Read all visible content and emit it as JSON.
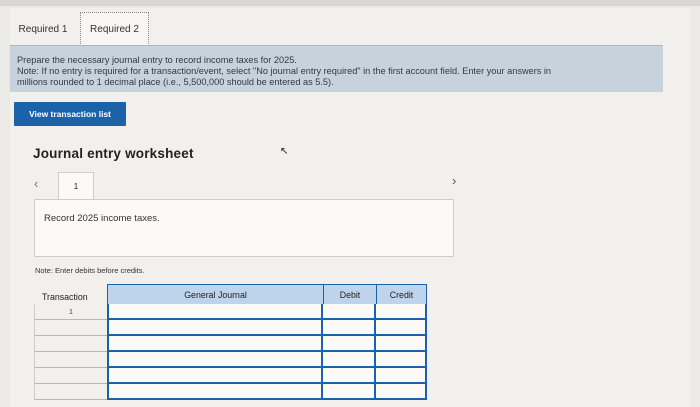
{
  "tabs": [
    "Required 1",
    "Required 2"
  ],
  "instructions": {
    "line1": "Prepare the necessary journal entry to record income taxes for 2025.",
    "line2": "Note: If no entry is required for a transaction/event, select \"No journal entry required\" in the first account field. Enter your answers in",
    "line3": "millions rounded to 1 decimal place (i.e., 5,500,000 should be entered as 5.5)."
  },
  "view_button": "View transaction list",
  "worksheet": {
    "title": "Journal entry worksheet",
    "page": "1",
    "record_text": "Record 2025 income taxes.",
    "note": "Note: Enter debits before credits."
  },
  "table": {
    "headers": [
      "Transaction",
      "General Journal",
      "Debit",
      "Credit"
    ],
    "rows": [
      {
        "transaction": "1",
        "account": "",
        "debit": "",
        "credit": ""
      },
      {
        "transaction": "",
        "account": "",
        "debit": "",
        "credit": ""
      },
      {
        "transaction": "",
        "account": "",
        "debit": "",
        "credit": ""
      },
      {
        "transaction": "",
        "account": "",
        "debit": "",
        "credit": ""
      },
      {
        "transaction": "",
        "account": "",
        "debit": "",
        "credit": ""
      },
      {
        "transaction": "",
        "account": "",
        "debit": "",
        "credit": ""
      }
    ]
  },
  "colors": {
    "accent": "#1b62a8",
    "instruction_bg": "#c6d3dc",
    "header_bg": "#bdd4ec"
  },
  "icons": {
    "prev": "chevron-left-icon",
    "next": "chevron-right-icon",
    "cursor": "mouse-cursor-icon"
  }
}
